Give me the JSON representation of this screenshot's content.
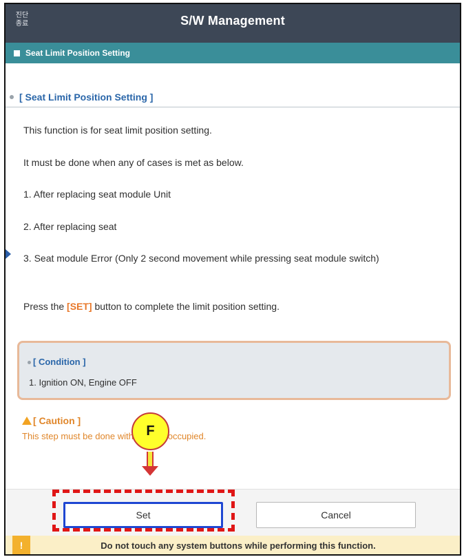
{
  "titlebar": {
    "exit_label": "진단\n종료",
    "title": "S/W Management"
  },
  "subbar": {
    "label": "Seat Limit Position Setting"
  },
  "section": {
    "heading": "[ Seat Limit Position Setting ]"
  },
  "body": {
    "line1": "This function is for seat limit position setting.",
    "line2": "It must be done when any of cases is met as below.",
    "line3": "1. After replacing seat module Unit",
    "line4": "2. After replacing seat",
    "line5": "3. Seat module Error (Only 2 second movement while pressing seat module switch)",
    "press_before": "Press the ",
    "press_set": "[SET]",
    "press_after": " button to complete the limit position setting."
  },
  "condition": {
    "title": "[ Condition ]",
    "item1": "1. Ignition ON, Engine OFF"
  },
  "caution": {
    "title": "[ Caution ]",
    "text": "This step must be done without seat occupied."
  },
  "annotation": {
    "badge": "F"
  },
  "buttons": {
    "set_label": "Set",
    "cancel_label": "Cancel"
  },
  "warning": {
    "icon": "!",
    "text": "Do not touch any system buttons while performing this function."
  },
  "colors": {
    "titlebar": "#3d4756",
    "subbar": "#3a8e99",
    "heading_blue": "#2a66a9",
    "caution_orange": "#e0862a",
    "highlight_red": "#e01616",
    "badge_yellow": "#ffff2b"
  }
}
